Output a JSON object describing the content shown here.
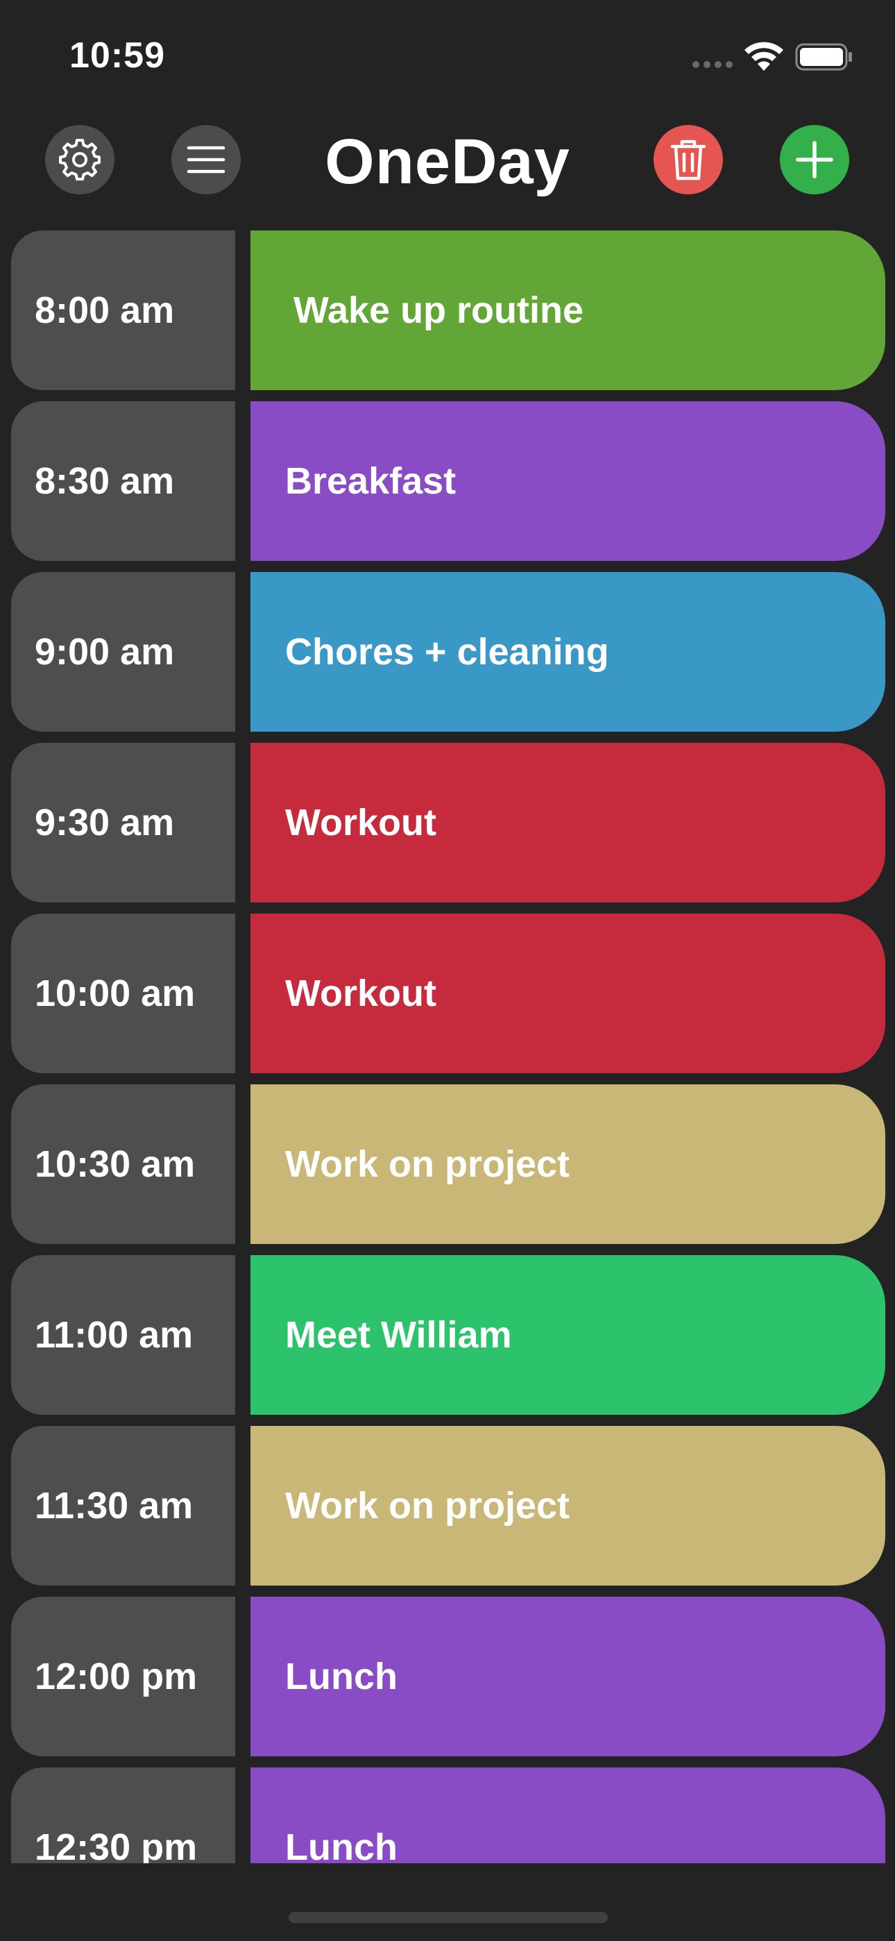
{
  "status_bar": {
    "time": "10:59",
    "icons": [
      "cellular-signal-icon",
      "wifi-icon",
      "battery-icon"
    ]
  },
  "header": {
    "title": "OneDay",
    "buttons": {
      "settings": "gear-icon",
      "menu": "hamburger-menu-icon",
      "delete": "trash-icon",
      "add": "plus-icon"
    }
  },
  "colors": {
    "background": "#232323",
    "time_cell": "#4e4e4e",
    "settings_button": "#4c4c4c",
    "delete_button": "#e55653",
    "add_button": "#34b04a"
  },
  "schedule": [
    {
      "time": "8:00 am",
      "title": "Wake up routine",
      "color": "#62a637"
    },
    {
      "time": "8:30 am",
      "title": "Breakfast",
      "color": "#8a4cc4"
    },
    {
      "time": "9:00 am",
      "title": "Chores + cleaning",
      "color": "#3a98c7"
    },
    {
      "time": "9:30 am",
      "title": "Workout",
      "color": "#c62b3d"
    },
    {
      "time": "10:00 am",
      "title": "Workout",
      "color": "#c62b3d"
    },
    {
      "time": "10:30 am",
      "title": "Work on project",
      "color": "#c8b777"
    },
    {
      "time": "11:00 am",
      "title": "Meet William",
      "color": "#2cc36c"
    },
    {
      "time": "11:30 am",
      "title": "Work on project",
      "color": "#c8b777"
    },
    {
      "time": "12:00 pm",
      "title": "Lunch",
      "color": "#8a4cc4"
    },
    {
      "time": "12:30 pm",
      "title": "Lunch",
      "color": "#8a4cc4"
    }
  ]
}
